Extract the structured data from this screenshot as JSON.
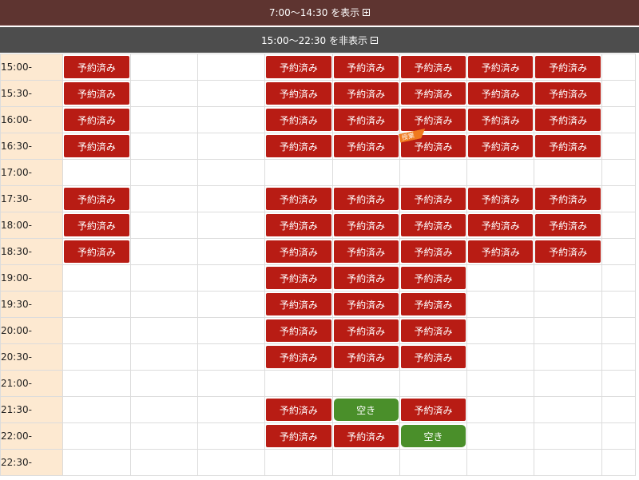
{
  "header": {
    "show_morning_label": "7:00〜14:30 を表示",
    "hide_evening_label": "15:00〜22:30 を非表示"
  },
  "labels": {
    "booked": "予約済み",
    "open": "空き",
    "promo_ribbon": "授業"
  },
  "rows": [
    {
      "time": "15:00-",
      "slots": [
        "booked",
        "empty",
        "empty",
        "booked",
        "booked",
        "booked",
        "booked",
        "booked",
        "empty"
      ]
    },
    {
      "time": "15:30-",
      "slots": [
        "booked",
        "empty",
        "empty",
        "booked",
        "booked",
        "booked",
        "booked",
        "booked",
        "empty"
      ]
    },
    {
      "time": "16:00-",
      "slots": [
        "booked",
        "empty",
        "empty",
        "booked",
        "booked",
        "booked",
        "booked",
        "booked",
        "empty"
      ]
    },
    {
      "time": "16:30-",
      "slots": [
        "booked",
        "empty",
        "empty",
        "booked",
        "booked",
        "booked-ribbon",
        "booked",
        "booked",
        "empty"
      ]
    },
    {
      "time": "17:00-",
      "slots": [
        "empty",
        "empty",
        "empty",
        "empty",
        "empty",
        "empty",
        "empty",
        "empty",
        "empty"
      ]
    },
    {
      "time": "17:30-",
      "slots": [
        "booked",
        "empty",
        "empty",
        "booked",
        "booked",
        "booked",
        "booked",
        "booked",
        "empty"
      ]
    },
    {
      "time": "18:00-",
      "slots": [
        "booked",
        "empty",
        "empty",
        "booked",
        "booked",
        "booked",
        "booked",
        "booked",
        "empty"
      ]
    },
    {
      "time": "18:30-",
      "slots": [
        "booked",
        "empty",
        "empty",
        "booked",
        "booked",
        "booked",
        "booked",
        "booked",
        "empty"
      ]
    },
    {
      "time": "19:00-",
      "slots": [
        "empty",
        "empty",
        "empty",
        "booked",
        "booked",
        "booked",
        "empty",
        "empty",
        "empty"
      ]
    },
    {
      "time": "19:30-",
      "slots": [
        "empty",
        "empty",
        "empty",
        "booked",
        "booked",
        "booked",
        "empty",
        "empty",
        "empty"
      ]
    },
    {
      "time": "20:00-",
      "slots": [
        "empty",
        "empty",
        "empty",
        "booked",
        "booked",
        "booked",
        "empty",
        "empty",
        "empty"
      ]
    },
    {
      "time": "20:30-",
      "slots": [
        "empty",
        "empty",
        "empty",
        "booked",
        "booked",
        "booked",
        "empty",
        "empty",
        "empty"
      ]
    },
    {
      "time": "21:00-",
      "slots": [
        "empty",
        "empty",
        "empty",
        "empty",
        "empty",
        "empty",
        "empty",
        "empty",
        "empty"
      ]
    },
    {
      "time": "21:30-",
      "slots": [
        "empty",
        "empty",
        "empty",
        "booked",
        "open",
        "booked",
        "empty",
        "empty",
        "empty"
      ]
    },
    {
      "time": "22:00-",
      "slots": [
        "empty",
        "empty",
        "empty",
        "booked",
        "booked",
        "open",
        "empty",
        "empty",
        "empty"
      ]
    },
    {
      "time": "22:30-",
      "slots": [
        "empty",
        "empty",
        "empty",
        "empty",
        "empty",
        "empty",
        "empty",
        "empty",
        "empty"
      ]
    }
  ],
  "colors": {
    "booked": "#b81c14",
    "open": "#4a8f2a",
    "time_column": "#fde9d1",
    "header_show": "#5e3430",
    "header_hide": "#4d4d4d",
    "ribbon": "#f07a1e"
  }
}
